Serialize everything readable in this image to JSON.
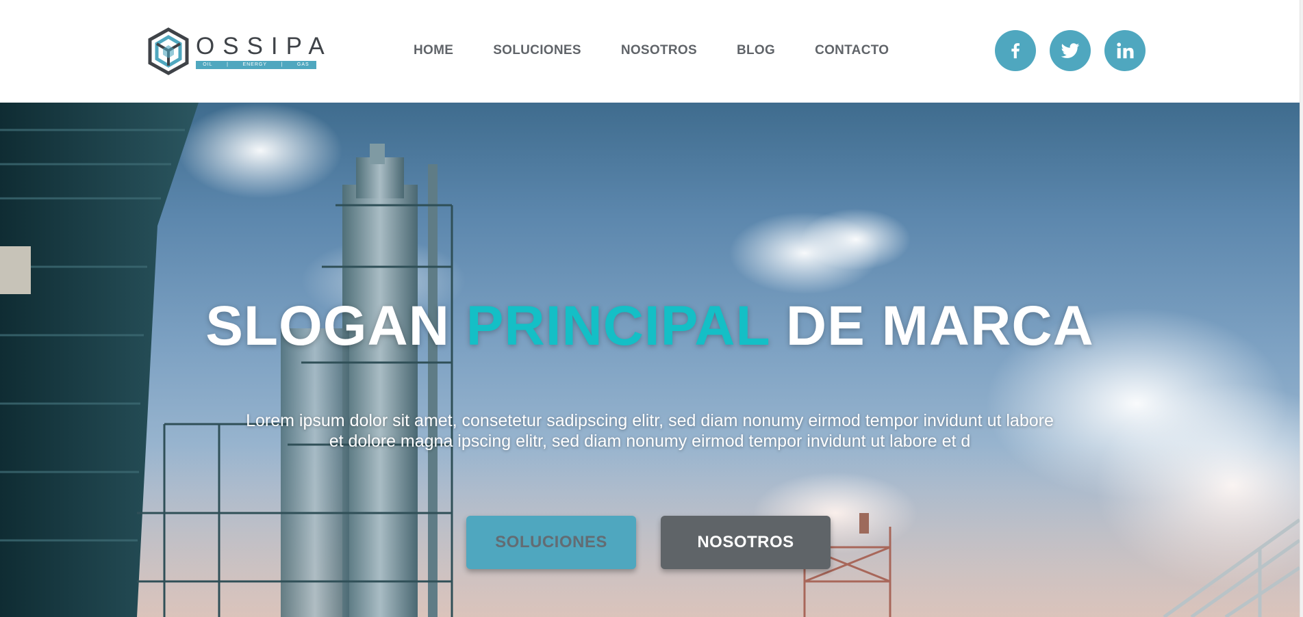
{
  "brand": {
    "name": "OSSIPA",
    "tagline_parts": [
      "OIL",
      "ENERGY",
      "GAS"
    ],
    "accent_color": "#4fa7bf"
  },
  "nav": {
    "items": [
      {
        "label": "HOME"
      },
      {
        "label": "SOLUCIONES"
      },
      {
        "label": "NOSOTROS"
      },
      {
        "label": "BLOG"
      },
      {
        "label": "CONTACTO"
      }
    ]
  },
  "social": {
    "items": [
      {
        "icon": "facebook-icon"
      },
      {
        "icon": "twitter-icon"
      },
      {
        "icon": "linkedin-icon"
      }
    ]
  },
  "hero": {
    "headline_part1": "SLOGAN ",
    "headline_accent": "PRINCIPAL",
    "headline_part2": " DE MARCA",
    "headline_accent_color": "#14bfc6",
    "body": "Lorem ipsum dolor sit amet, consetetur sadipscing elitr, sed diam nonumy eirmod tempor invidunt ut labore et dolore magna ipscing elitr, sed diam nonumy eirmod tempor invidunt ut labore et d",
    "primary_cta": "SOLUCIONES",
    "secondary_cta": "NOSOTROS"
  }
}
